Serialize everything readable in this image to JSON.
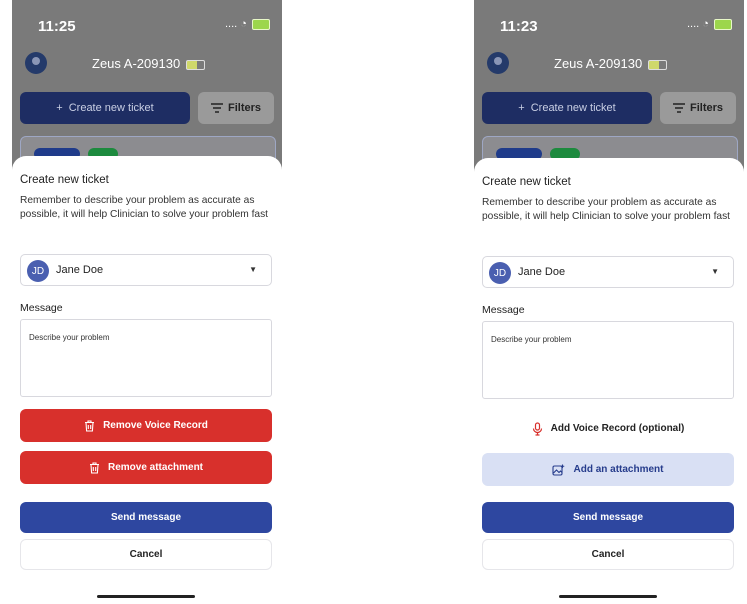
{
  "screens": [
    {
      "status_time": "11:25",
      "status_dots": "....",
      "device_name": "Zeus A-209130",
      "create_ticket_label": "Create new ticket",
      "filters_label": "Filters",
      "sheet": {
        "title": "Create new ticket",
        "description": "Remember to describe your problem as accurate as possible, it will help Clinician to solve your problem fast",
        "selected_user": {
          "initials": "JD",
          "name": "Jane Doe"
        },
        "message_label": "Message",
        "message_placeholder": "Describe your problem",
        "voice_button_label": "Remove Voice Record",
        "attachment_button_label": "Remove attachment",
        "send_label": "Send message",
        "cancel_label": "Cancel"
      }
    },
    {
      "status_time": "11:23",
      "status_dots": "....",
      "device_name": "Zeus A-209130",
      "create_ticket_label": "Create new ticket",
      "filters_label": "Filters",
      "sheet": {
        "title": "Create new ticket",
        "description": "Remember to describe your problem as accurate as possible, it will help Clinician to solve your problem fast",
        "selected_user": {
          "initials": "JD",
          "name": "Jane Doe"
        },
        "message_label": "Message",
        "message_placeholder": "Describe your problem",
        "voice_button_label": "Add Voice Record (optional)",
        "attachment_button_label": "Add an attachment",
        "send_label": "Send message",
        "cancel_label": "Cancel"
      }
    }
  ],
  "colors": {
    "danger": "#d8302c",
    "primary": "#2e47a0",
    "primary_light": "#d9e0f4"
  },
  "icons": {
    "delete": "trash-icon",
    "voice": "microphone-icon",
    "attachment": "add-image-icon",
    "dropdown": "caret-down-icon",
    "filters": "filter-lines-icon"
  }
}
